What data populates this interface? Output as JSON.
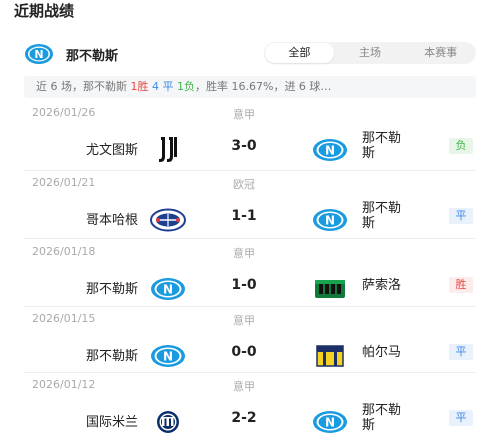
{
  "section_title": "近期战绩",
  "team": {
    "name": "那不勒斯"
  },
  "tabs": [
    {
      "label": "全部",
      "active": true
    },
    {
      "label": "主场",
      "active": false
    },
    {
      "label": "本赛事",
      "active": false
    }
  ],
  "summary": {
    "prefix": "近 6 场，那不勒斯 ",
    "wins": "1胜",
    "draws": "4 平",
    "losses": "1负",
    "suffix": "，胜率 16.67%，进 6 球…"
  },
  "matches": [
    {
      "date": "2026/01/26",
      "competition": "意甲",
      "home": "尤文图斯",
      "home_logo": "juventus-icon",
      "score": "3-0",
      "away": "那不勒\n斯",
      "away_logo": "napoli-icon",
      "result": "负",
      "result_type": "lose"
    },
    {
      "date": "2026/01/21",
      "competition": "欧冠",
      "home": "哥本哈根",
      "home_logo": "copenhagen-icon",
      "score": "1-1",
      "away": "那不勒\n斯",
      "away_logo": "napoli-icon",
      "result": "平",
      "result_type": "draw"
    },
    {
      "date": "2026/01/18",
      "competition": "意甲",
      "home": "那不勒斯",
      "home_logo": "napoli-icon",
      "score": "1-0",
      "away": "萨索洛",
      "away_logo": "sassuolo-icon",
      "result": "胜",
      "result_type": "win"
    },
    {
      "date": "2026/01/15",
      "competition": "意甲",
      "home": "那不勒斯",
      "home_logo": "napoli-icon",
      "score": "0-0",
      "away": "帕尔马",
      "away_logo": "parma-icon",
      "result": "平",
      "result_type": "draw"
    },
    {
      "date": "2026/01/12",
      "competition": "意甲",
      "home": "国际米兰",
      "home_logo": "inter-icon",
      "score": "2-2",
      "away": "那不勒\n斯",
      "away_logo": "napoli-icon",
      "result": "平",
      "result_type": "draw"
    }
  ],
  "colors": {
    "win": "#e5483f",
    "draw": "#3f8ae8",
    "lose": "#41b349",
    "napoli": "#1a9be0"
  }
}
